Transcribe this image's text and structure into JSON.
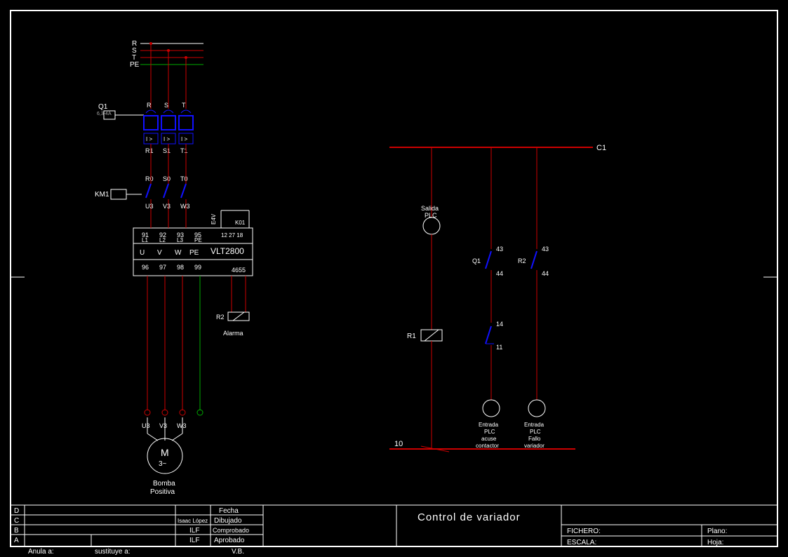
{
  "title_block": {
    "rows": [
      "D",
      "C",
      "B",
      "A"
    ],
    "row_c_text": "Isaac López",
    "row_b_ilf": "ILF",
    "row_a_ilf": "ILF",
    "anula": "Anula a:",
    "sustituye": "sustituye a:",
    "fecha": "Fecha",
    "dibujado": "Dibujado",
    "comprobado": "Comprobado",
    "aprobado": "Aprobado",
    "vb": "V.B.",
    "title": "Control de variador",
    "fichero": "FICHERO:",
    "plano": "Plano:",
    "escala": "ESCALA:",
    "hoja": "Hoja:"
  },
  "power": {
    "supply": [
      "R",
      "S",
      "T",
      "PE"
    ],
    "q1": {
      "label": "Q1",
      "sub": "6,3-4A",
      "in": [
        "R",
        "S",
        "T"
      ],
      "mid": [
        "I >",
        "I >",
        "I >"
      ],
      "out": [
        "R1",
        "S1",
        "T1"
      ]
    },
    "km1": {
      "label": "KM1",
      "in": [
        "R0",
        "S0",
        "T0"
      ],
      "out": [
        "U3",
        "V3",
        "W3"
      ]
    },
    "vlt": {
      "model": "VLT2800",
      "code": "4655",
      "e4v": "E4V",
      "k01": "K01",
      "relay_terms": "12 27 18",
      "top": [
        "91",
        "92",
        "93",
        "95"
      ],
      "top_lbl": [
        "L1",
        "L2",
        "L3",
        "PE"
      ],
      "mid": [
        "U",
        "V",
        "W",
        "PE"
      ],
      "bot": [
        "96",
        "97",
        "98",
        "99"
      ]
    },
    "r2": {
      "label": "R2",
      "alarm": "Alarma"
    },
    "motor": {
      "terms": [
        "U3",
        "V3",
        "W3"
      ],
      "sym": "M",
      "phase": "3~",
      "name1": "Bomba",
      "name2": "Positiva"
    }
  },
  "control": {
    "bus_top": "C1",
    "bus_bot": "10",
    "salida": {
      "l1": "Salida",
      "l2": "PLC"
    },
    "r1": "R1",
    "q1_contact": {
      "lbl": "Q1",
      "t": "43",
      "b": "44"
    },
    "r2_contact": {
      "lbl": "R2",
      "t": "43",
      "b": "44"
    },
    "r1_contact": {
      "t": "14",
      "b": "11"
    },
    "in1": {
      "l1": "Entrada",
      "l2": "PLC",
      "l3": "acuse",
      "l4": "contactor"
    },
    "in2": {
      "l1": "Entrada",
      "l2": "PLC",
      "l3": "Fallo",
      "l4": "variador"
    }
  }
}
